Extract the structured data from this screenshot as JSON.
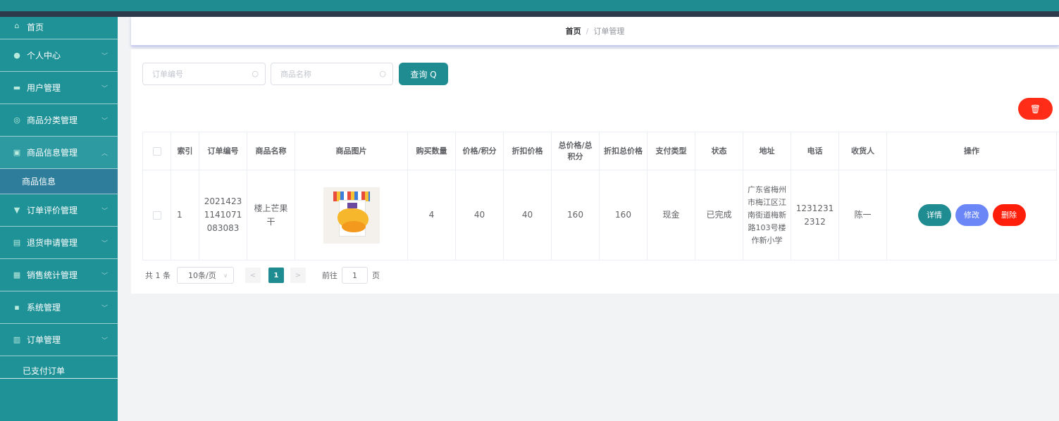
{
  "breadcrumb": {
    "home": "首页",
    "separator": "/",
    "current": "订单管理"
  },
  "sidebar": {
    "items": [
      {
        "label": "首页",
        "icon": "home-icon"
      },
      {
        "label": "个人中心",
        "icon": "user-icon"
      },
      {
        "label": "用户管理",
        "icon": "users-icon"
      },
      {
        "label": "商品分类管理",
        "icon": "category-icon"
      },
      {
        "label": "商品信息管理",
        "icon": "goods-icon"
      },
      {
        "label": "商品信息"
      },
      {
        "label": "订单评价管理",
        "icon": "comment-icon"
      },
      {
        "label": "退货申请管理",
        "icon": "return-icon"
      },
      {
        "label": "销售统计管理",
        "icon": "chart-icon"
      },
      {
        "label": "系统管理",
        "icon": "settings-icon"
      },
      {
        "label": "订单管理",
        "icon": "order-icon"
      },
      {
        "label": "已支付订单"
      }
    ]
  },
  "search": {
    "order_no_placeholder": "订单编号",
    "goods_name_placeholder": "商品名称",
    "query_label": "查询 Q"
  },
  "table": {
    "headers": [
      "索引",
      "订单编号",
      "商品名称",
      "商品图片",
      "购买数量",
      "价格/积分",
      "折扣价格",
      "总价格/总积分",
      "折扣总价格",
      "支付类型",
      "状态",
      "地址",
      "电话",
      "收货人",
      "操作"
    ],
    "rows": [
      {
        "index": "1",
        "order_no": "20214231141071083083",
        "goods_name": "楼上芒果干",
        "quantity": "4",
        "price": "40",
        "discount_price": "40",
        "total_price": "160",
        "discount_total": "160",
        "pay_type": "现金",
        "status": "已完成",
        "address": "广东省梅州市梅江区江南街道梅新路103号楼作新小学",
        "phone": "12312312312",
        "receiver": "陈一",
        "actions": {
          "detail": "详情",
          "edit": "修改",
          "delete": "删除"
        }
      }
    ]
  },
  "pagination": {
    "total": "共 1 条",
    "page_size": "10条/页",
    "current_page": "1",
    "goto_prefix": "前往",
    "goto_value": "1",
    "goto_suffix": "页"
  },
  "colors": {
    "primary": "#1f8c92",
    "danger": "#ff1e0a",
    "edit": "#6b87f7",
    "sidebar": "#1f9297"
  }
}
